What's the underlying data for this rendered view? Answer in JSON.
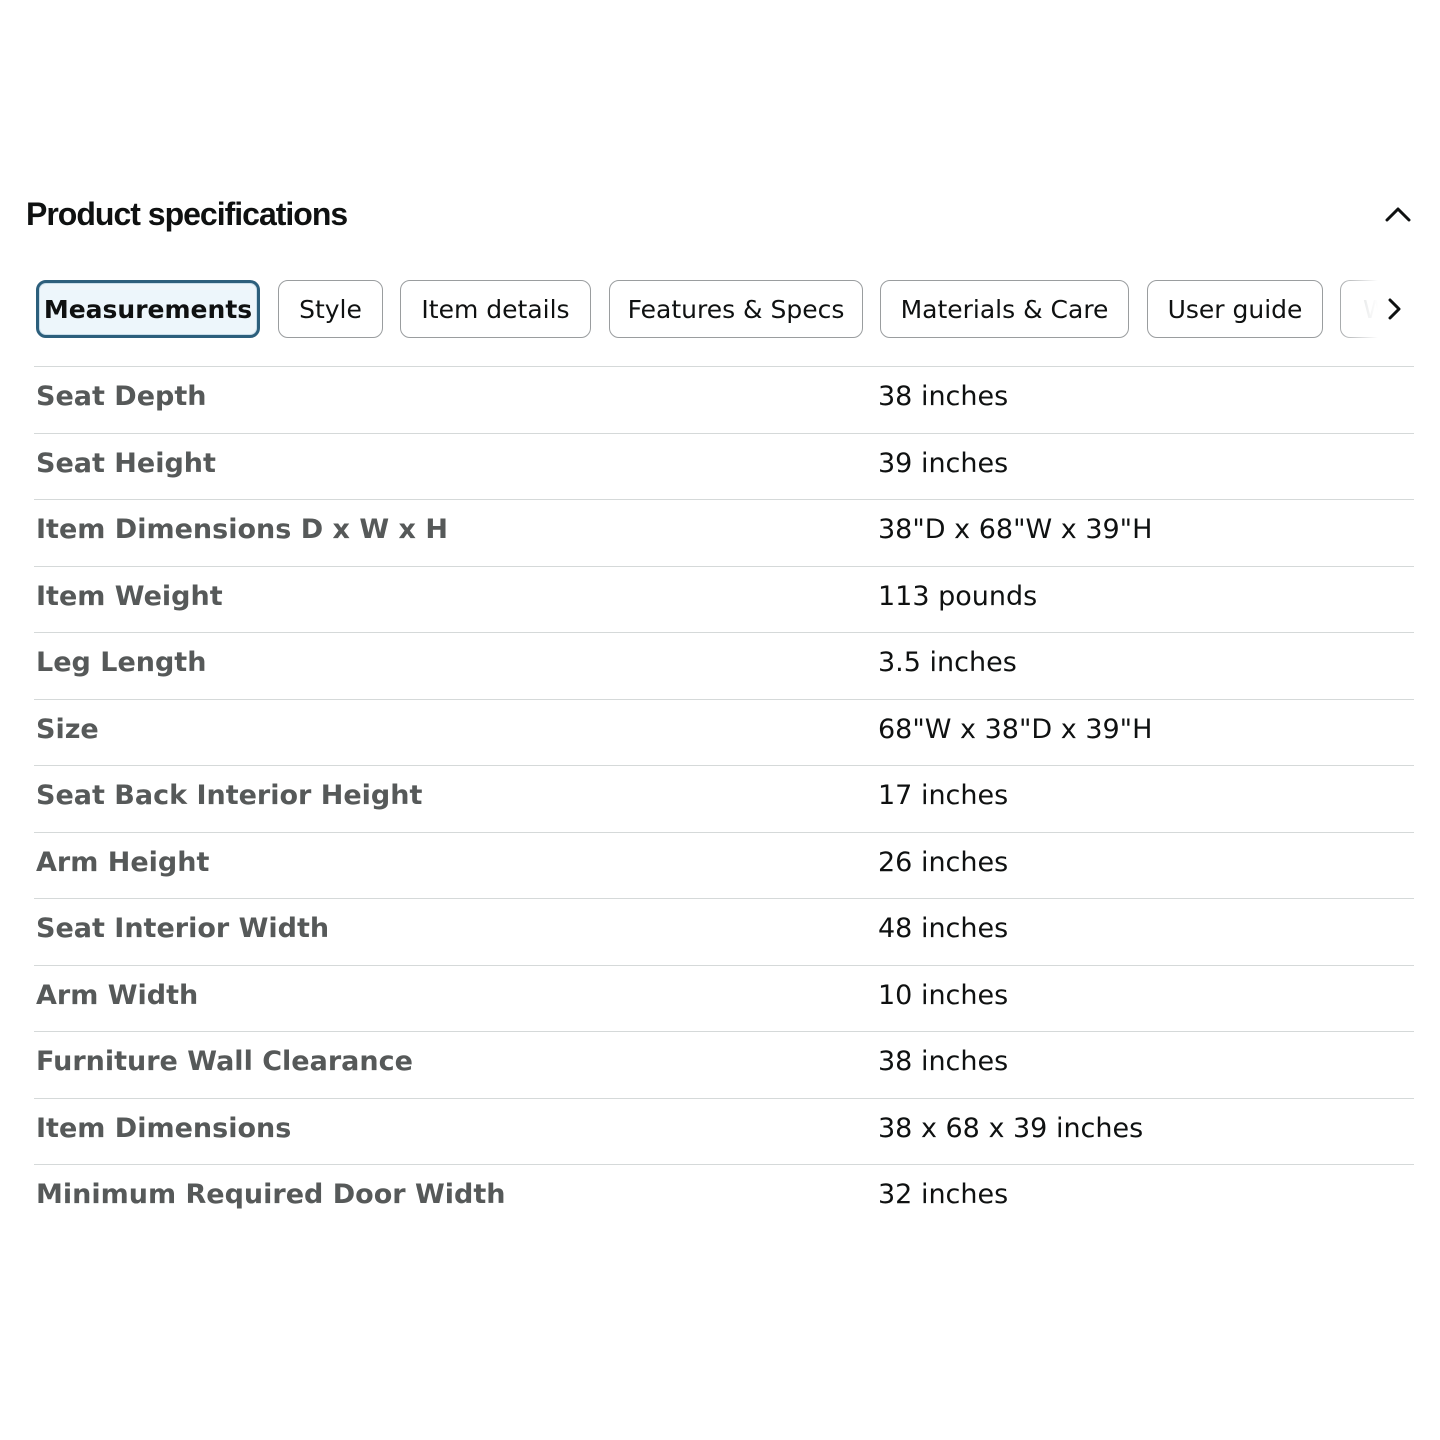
{
  "section": {
    "title": "Product specifications",
    "collapse_icon": "chevron-up-icon"
  },
  "tabs": [
    {
      "label": "Measurements",
      "active": true
    },
    {
      "label": "Style",
      "active": false
    },
    {
      "label": "Item details",
      "active": false
    },
    {
      "label": "Features & Specs",
      "active": false
    },
    {
      "label": "Materials & Care",
      "active": false
    },
    {
      "label": "User guide",
      "active": false
    },
    {
      "label": "Wa",
      "active": false
    }
  ],
  "tabs_scroll_icon": "chevron-right-icon",
  "specs": [
    {
      "label": "Seat Depth",
      "value": "38 inches"
    },
    {
      "label": "Seat Height",
      "value": "39 inches"
    },
    {
      "label": "Item Dimensions D x W x H",
      "value": "38\"D x 68\"W x 39\"H"
    },
    {
      "label": "Item Weight",
      "value": "113 pounds"
    },
    {
      "label": "Leg Length",
      "value": "3.5 inches"
    },
    {
      "label": "Size",
      "value": "68\"W x 38\"D x 39\"H"
    },
    {
      "label": "Seat Back Interior Height",
      "value": "17 inches"
    },
    {
      "label": "Arm Height",
      "value": "26 inches"
    },
    {
      "label": "Seat Interior Width",
      "value": "48 inches"
    },
    {
      "label": "Arm Width",
      "value": "10 inches"
    },
    {
      "label": "Furniture Wall Clearance",
      "value": "38 inches"
    },
    {
      "label": "Item Dimensions",
      "value": "38 x 68 x 39 inches"
    },
    {
      "label": "Minimum Required Door Width",
      "value": "32 inches"
    }
  ],
  "colors": {
    "active_tab_border": "#2c5f7c",
    "active_tab_bg": "#edf6fb",
    "label_text": "#565959",
    "value_text": "#0f1111",
    "divider": "#d5d9d9"
  }
}
